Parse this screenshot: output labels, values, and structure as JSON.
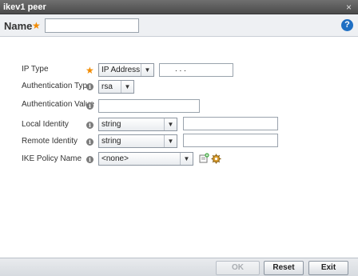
{
  "window": {
    "title": "ikev1 peer",
    "close_glyph": "×"
  },
  "name_section": {
    "label": "Name",
    "value": "",
    "help_glyph": "?"
  },
  "form": {
    "ip_type": {
      "label": "IP Type",
      "selected": "IP Address",
      "ip_value": ".      .      ."
    },
    "auth_type": {
      "label": "Authentication Type",
      "selected": "rsa"
    },
    "auth_value": {
      "label": "Authentication Value",
      "value": ""
    },
    "local_identity": {
      "label": "Local Identity",
      "selected": "string",
      "value": ""
    },
    "remote_identity": {
      "label": "Remote Identity",
      "selected": "string",
      "value": ""
    },
    "ike_policy": {
      "label": "IKE Policy Name",
      "selected": "<none>"
    }
  },
  "icons": {
    "required": "star-icon",
    "info": "info-icon",
    "add": "add-policy-icon",
    "configure": "gear-icon"
  },
  "footer": {
    "ok_label": "OK",
    "reset_label": "Reset",
    "exit_label": "Exit"
  },
  "colors": {
    "accent": "#1f6fc3",
    "required_star": "#f28b00",
    "titlebar": "#5a5a5a"
  }
}
